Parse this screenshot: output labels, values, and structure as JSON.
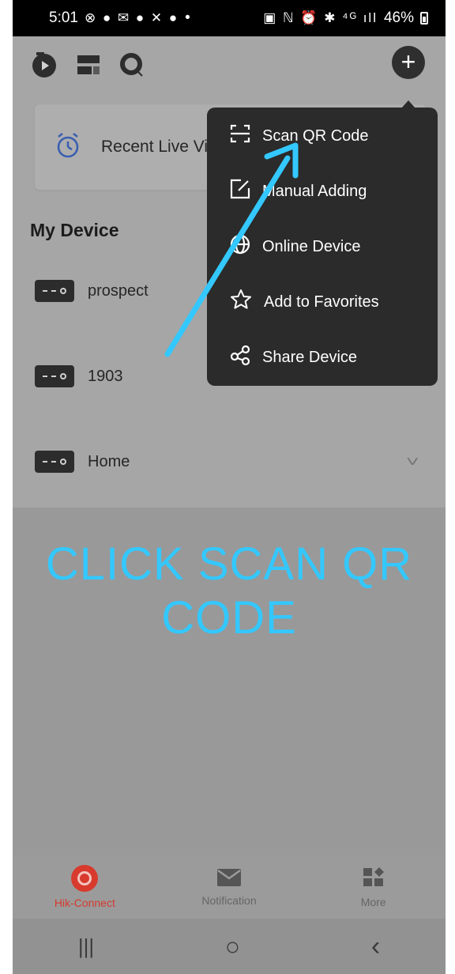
{
  "status_bar": {
    "time": "5:01",
    "notification_icons": "⊗ ● ✉ ● ✕ ●",
    "dot": "•",
    "system_icons": "▣ ℕ ⏰ ✱ ⁴ᴳ ıll",
    "battery": "46%"
  },
  "top_bar": {
    "icons": [
      "play-circle-icon",
      "layout-grid-icon",
      "search-icon",
      "add-icon"
    ],
    "add_symbol": "+"
  },
  "recent": {
    "label": "Recent Live View",
    "chevron": "›"
  },
  "my_device": {
    "title": "My Device",
    "devices": [
      {
        "name": "prospect",
        "chevron": "˅"
      },
      {
        "name": "1903",
        "chevron": "˅"
      },
      {
        "name": "Home",
        "chevron": "˅"
      }
    ]
  },
  "menu": {
    "items": [
      {
        "label": "Scan QR Code",
        "icon": "scan-qr-icon"
      },
      {
        "label": "Manual Adding",
        "icon": "edit-icon"
      },
      {
        "label": "Online Device",
        "icon": "globe-icon"
      },
      {
        "label": "Add to Favorites",
        "icon": "star-icon"
      },
      {
        "label": "Share Device",
        "icon": "share-icon"
      }
    ]
  },
  "caption": {
    "line1": "CLICK SCAN QR",
    "line2": "CODE",
    "color": "#33c8ff"
  },
  "bottom_nav": {
    "items": [
      {
        "label": "Hik-Connect",
        "active": true
      },
      {
        "label": "Notification",
        "active": false
      },
      {
        "label": "More",
        "active": false
      }
    ],
    "active_color": "#d43a2e"
  },
  "system_nav": {
    "recents": "|||",
    "home": "○",
    "back": "‹"
  }
}
